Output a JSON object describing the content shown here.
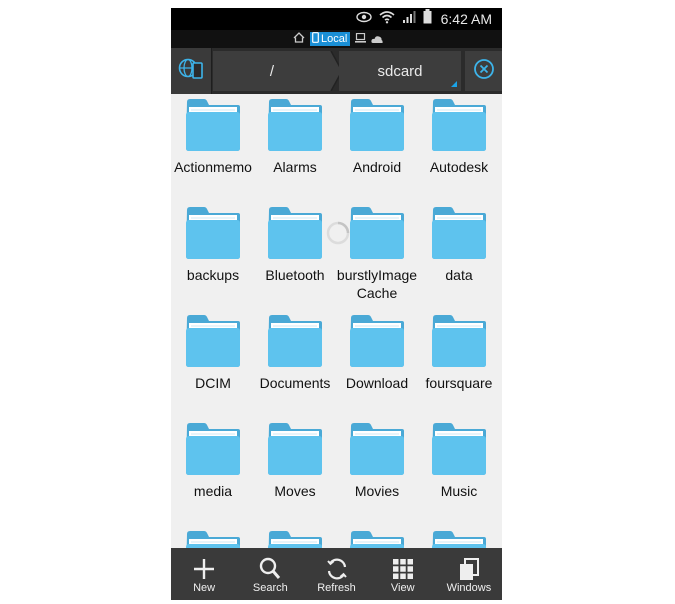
{
  "status_bar": {
    "time": "6:42 AM",
    "icons": [
      "eye-icon",
      "wifi-icon",
      "signal-icon",
      "battery-icon"
    ]
  },
  "location_bar": {
    "icons": [
      "home-icon",
      "phone-icon",
      "computer-icon",
      "cloud-icon"
    ],
    "active_label": "Local"
  },
  "path_bar": {
    "root": "/",
    "current": "sdcard",
    "icons": [
      "network-icon",
      "close-circle-icon"
    ]
  },
  "folders": [
    {
      "name": "Actionmemo"
    },
    {
      "name": "Alarms"
    },
    {
      "name": "Android"
    },
    {
      "name": "Autodesk"
    },
    {
      "name": "backups"
    },
    {
      "name": "Bluetooth"
    },
    {
      "name": "burstlyImageCache"
    },
    {
      "name": "data"
    },
    {
      "name": "DCIM"
    },
    {
      "name": "Documents"
    },
    {
      "name": "Download"
    },
    {
      "name": "foursquare"
    },
    {
      "name": "media"
    },
    {
      "name": "Moves"
    },
    {
      "name": "Movies"
    },
    {
      "name": "Music"
    }
  ],
  "toolbar": {
    "new_label": "New",
    "search_label": "Search",
    "refresh_label": "Refresh",
    "view_label": "View",
    "windows_label": "Windows"
  },
  "colors": {
    "folder": "#5ec3ee",
    "folder_tab": "#4aa9d6",
    "accent": "#1a8fd6",
    "toolbar": "#3a3a3a"
  }
}
